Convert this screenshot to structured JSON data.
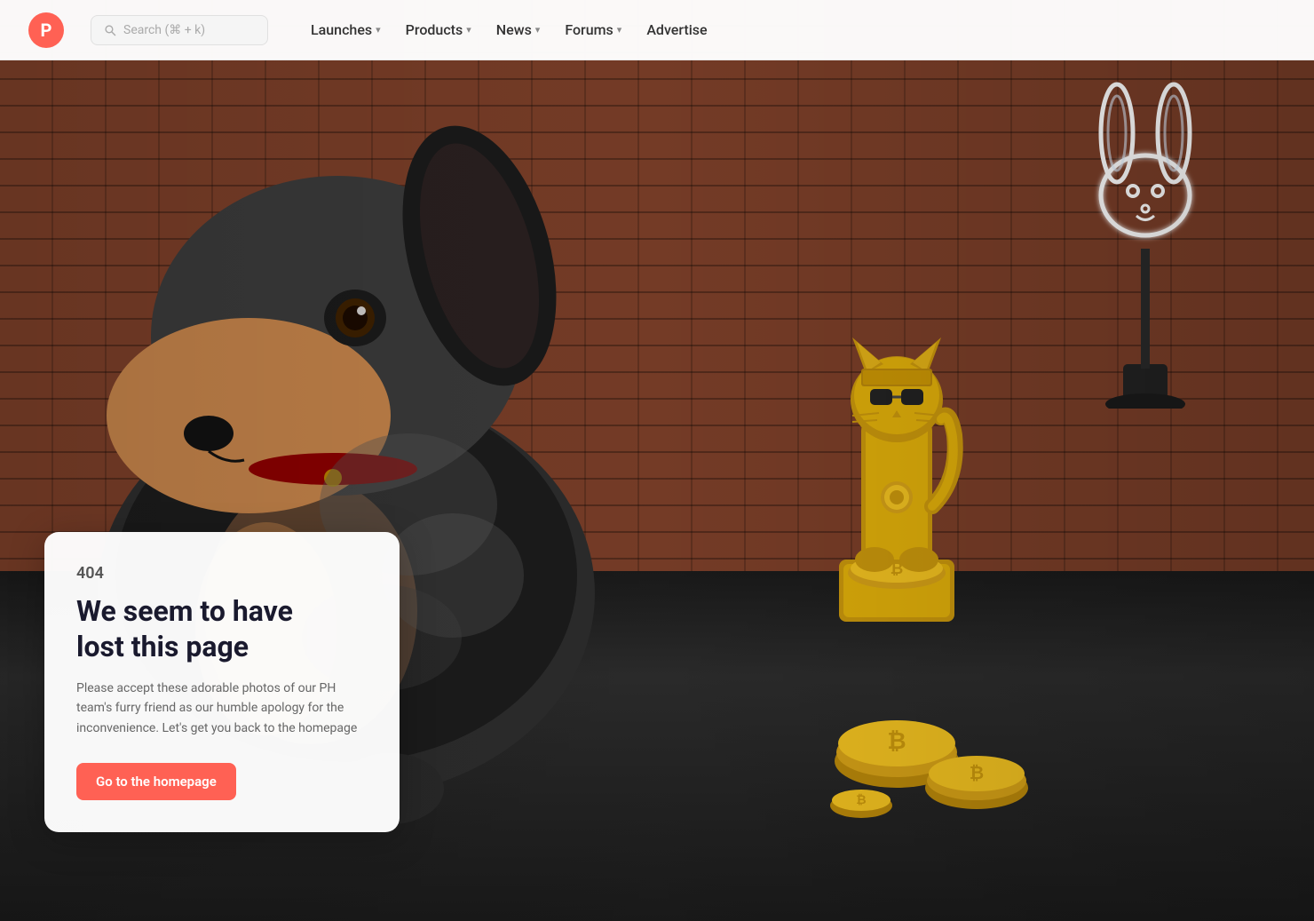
{
  "navbar": {
    "logo_letter": "P",
    "search_placeholder": "Search (⌘ + k)",
    "nav_items": [
      {
        "label": "Launches",
        "has_chevron": true
      },
      {
        "label": "Products",
        "has_chevron": true
      },
      {
        "label": "News",
        "has_chevron": true
      },
      {
        "label": "Forums",
        "has_chevron": true
      },
      {
        "label": "Advertise",
        "has_chevron": false
      }
    ]
  },
  "error_page": {
    "code": "404",
    "title_line1": "We seem to have",
    "title_line2": "lost this page",
    "description": "Please accept these adorable photos of our PH team's furry friend as our humble apology for the inconvenience. Let's get you back to the homepage",
    "cta_label": "Go to the homepage"
  },
  "colors": {
    "brand_red": "#ff6154",
    "nav_text": "#333333",
    "error_code_color": "#555555",
    "error_title_color": "#1a1a2e",
    "description_color": "#666666"
  }
}
